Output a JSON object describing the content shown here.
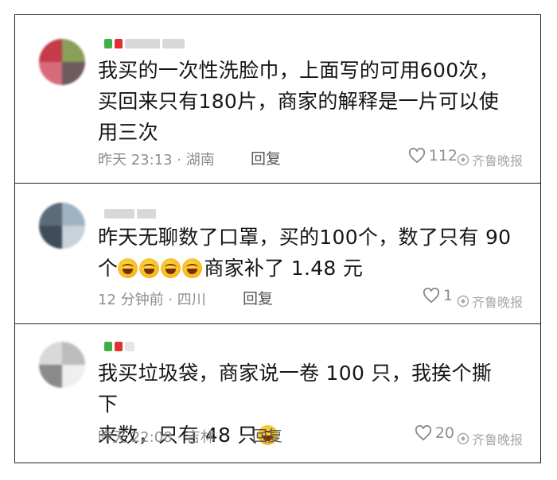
{
  "comments": [
    {
      "text_lines": [
        "我买的一次性洗脸巾，上面写的可用600次，",
        "买回来只有180片，商家的解释是一片可以使",
        "用三次"
      ],
      "meta": "昨天 23:13 · 湖南",
      "reply": "回复",
      "likes": "112",
      "avatar_colors": [
        "#c43c4a",
        "#8aa05a",
        "#d86b7a",
        "#6d5b5e"
      ]
    },
    {
      "text_lines": [
        "昨天无聊数了口罩，买的100个，数了只有 90",
        "个"
      ],
      "text_line2_suffix": "商家补了 1.48 元",
      "emoji_count": 4,
      "meta": "12 分钟前 · 四川",
      "reply": "回复",
      "likes": "1",
      "avatar_colors": [
        "#5c6b7a",
        "#9fb3c3",
        "#3f4d5a",
        "#c7d2da"
      ]
    },
    {
      "text_lines": [
        "我买垃圾袋，商家说一卷 100 只，我挨个撕下",
        "来数，只有 48 只"
      ],
      "emoji_count": 1,
      "meta": "昨天 22:08 · 吉林",
      "reply": "回复",
      "likes": "20",
      "avatar_colors": [
        "#d9d9d9",
        "#bdbdbd",
        "#8a8a8a",
        "#efefef"
      ]
    }
  ],
  "watermark": "齐鲁晚报",
  "icons": {
    "like": "heart-outline-icon",
    "watermark": "newspaper-logo-icon",
    "emoji": "rofl-emoji-icon"
  }
}
